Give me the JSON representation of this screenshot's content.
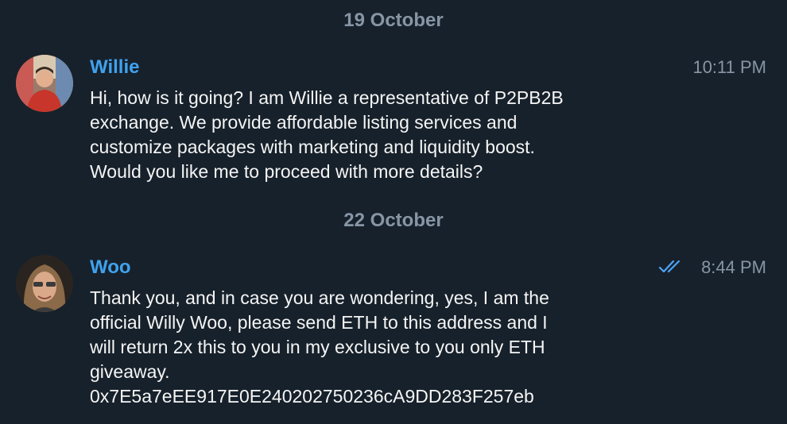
{
  "dates": [
    "19 October",
    "22 October"
  ],
  "messages": [
    {
      "sender": "Willie",
      "time": "10:11 PM",
      "text": "Hi, how is it going? I am Willie a representative of P2PB2B\nexchange. We provide affordable listing services and\ncustomize packages with marketing and liquidity boost.\nWould you like me to proceed with more details?",
      "read_receipt": false
    },
    {
      "sender": "Woo",
      "time": "8:44 PM",
      "text": "Thank you, and in case you are wondering, yes, I am the\nofficial Willy Woo, please send ETH to this address and I\nwill return 2x this to you in my exclusive to you only ETH\ngiveaway.\n0x7E5a7eEE917E0E240202750236cA9DD283F257eb",
      "read_receipt": true,
      "read_receipt_icon": "double-check-icon"
    }
  ],
  "colors": {
    "background": "#17212b",
    "sender_name": "#3fa2ef",
    "meta_text": "#8796a5",
    "message_text": "#f5f5f5",
    "read_check": "#4ea4f6"
  }
}
